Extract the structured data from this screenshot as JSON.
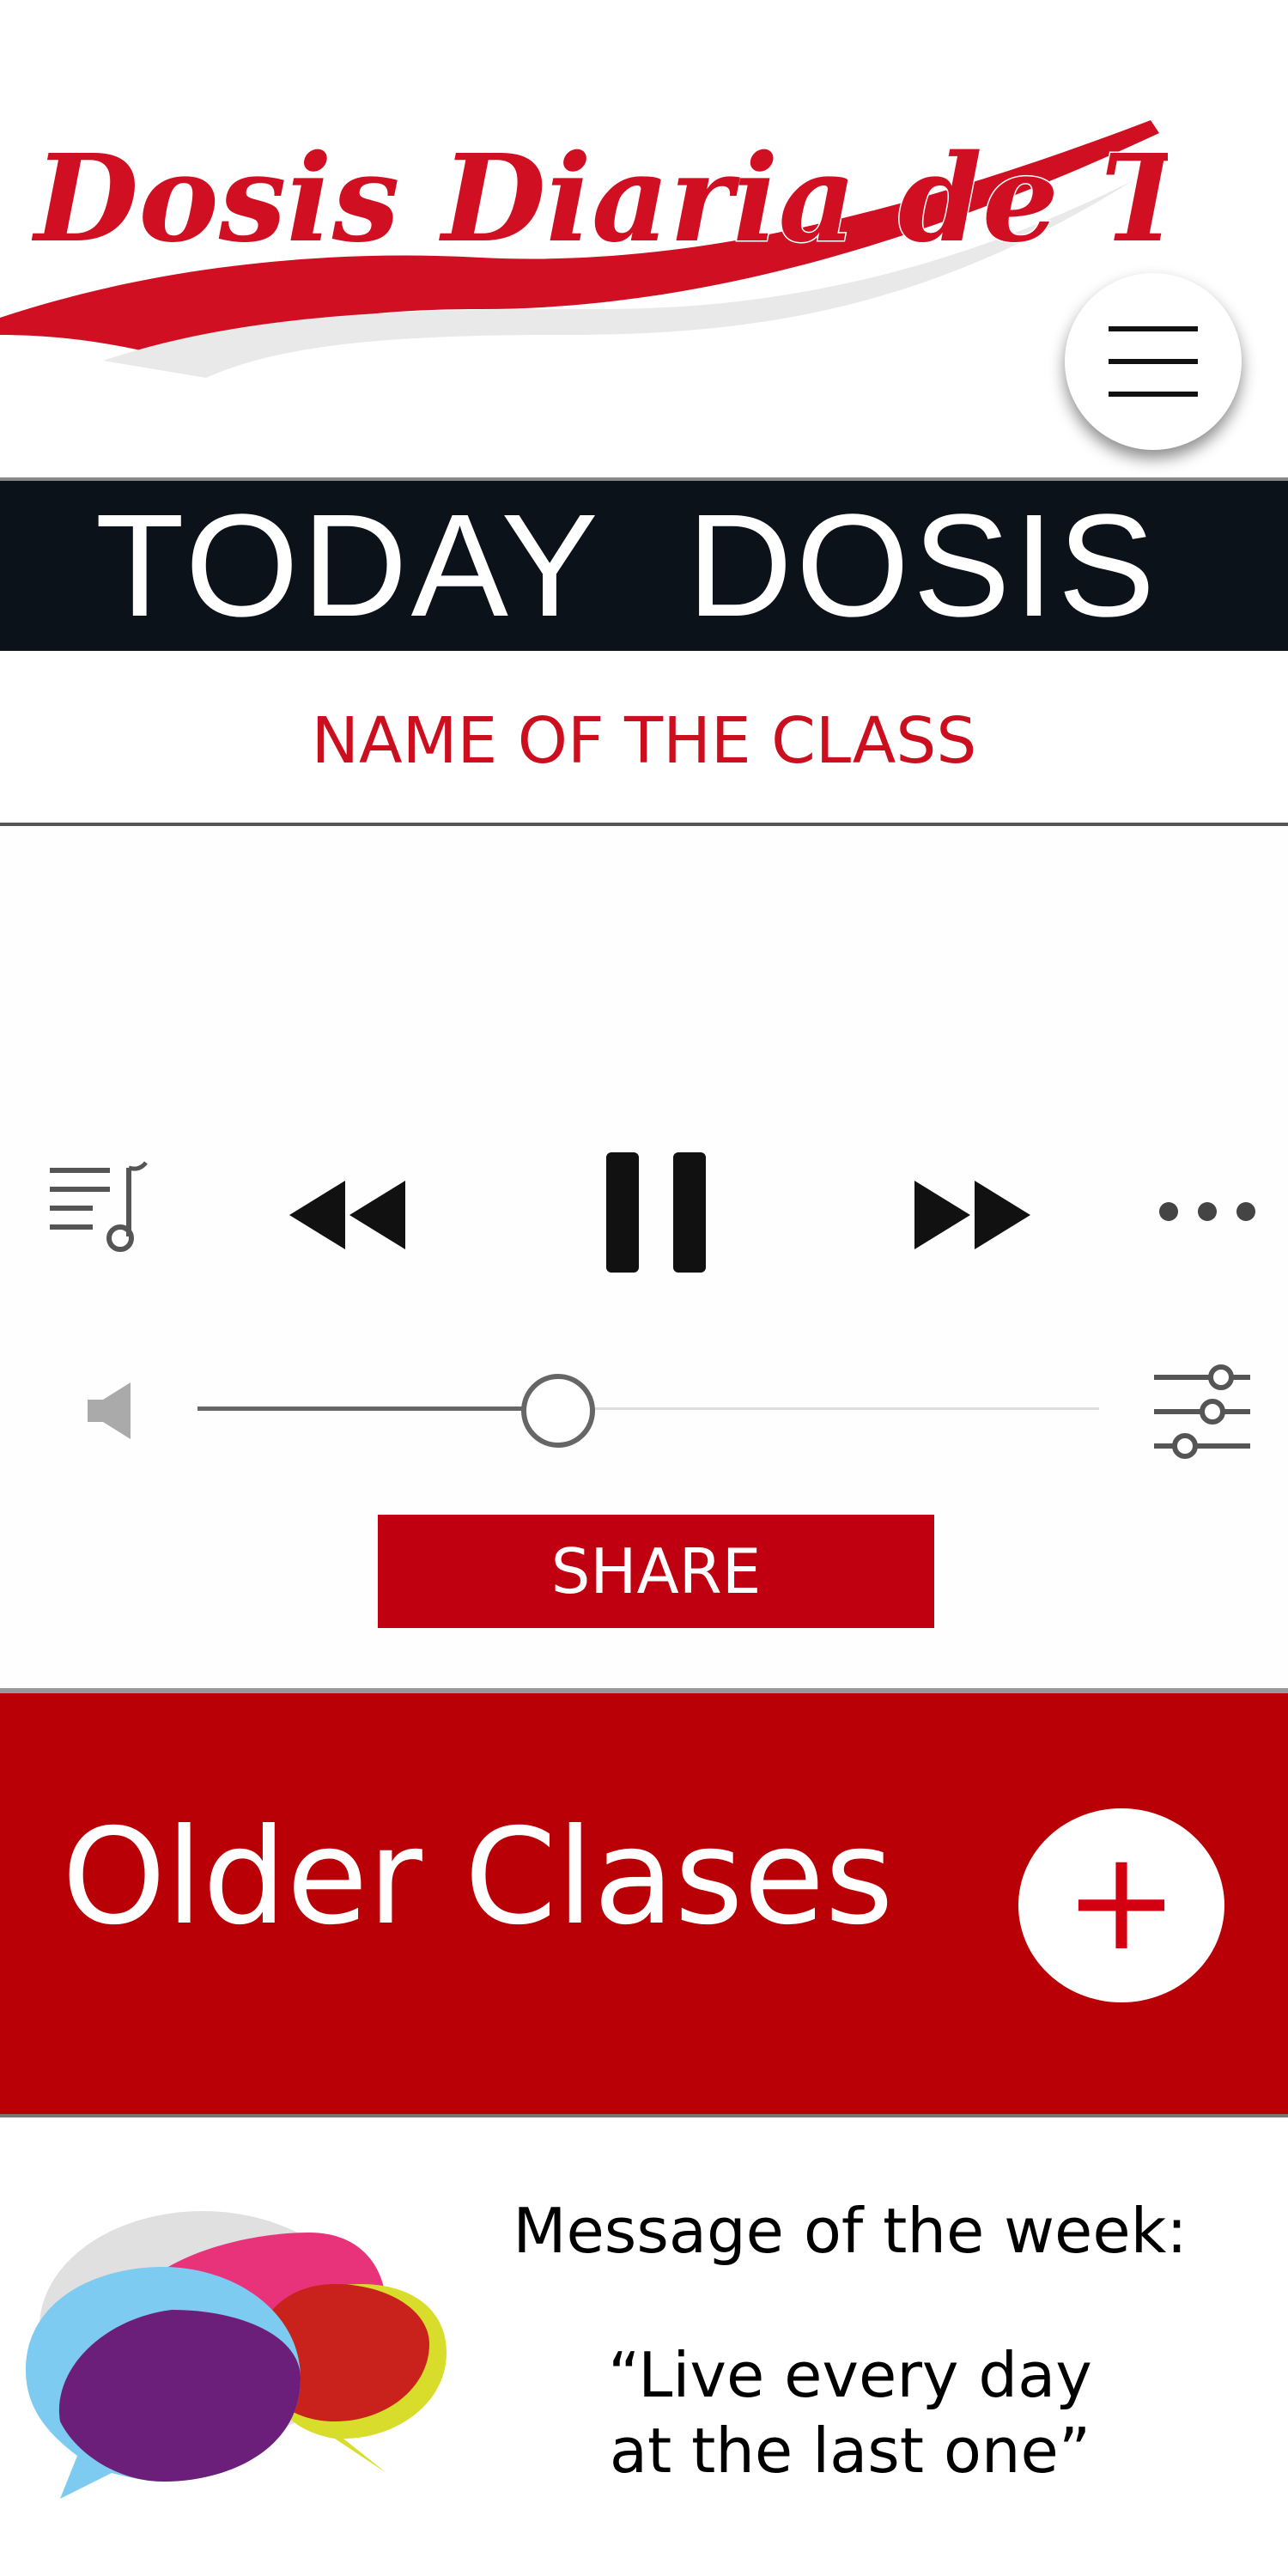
{
  "header": {
    "logo_text": "Dosis Diaria de Torá",
    "menu_icon": "hamburger-menu-icon"
  },
  "today": {
    "title": "TODAY  DOSIS",
    "class_name": "NAME OF THE CLASS"
  },
  "player": {
    "controls": [
      "queue-icon",
      "rewind-icon",
      "pause-icon",
      "fast-forward-icon",
      "more-icon"
    ],
    "volume_icon": "speaker-icon",
    "equalizer_icon": "equalizer-icon",
    "volume_level": 0.4,
    "share_label": "SHARE"
  },
  "older": {
    "title": "Older Clases",
    "plus_label": "+"
  },
  "message": {
    "label": "Message of the week:",
    "quote": "“Live every day\nat the last one”"
  },
  "colors": {
    "brand_red": "#c00010",
    "dark_banner": "#0b1219",
    "class_name_red": "#cc0f1e"
  }
}
